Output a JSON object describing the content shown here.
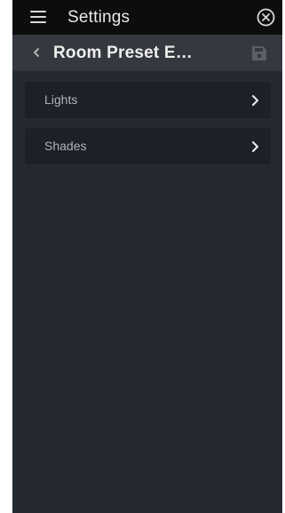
{
  "header": {
    "title": "Settings",
    "menu_icon": "hamburger-menu-icon",
    "close_icon": "close-circle-icon"
  },
  "subheader": {
    "title": "Room Preset E…",
    "back_icon": "chevron-left-icon",
    "save_icon": "floppy-disk-icon"
  },
  "items": [
    {
      "label": "Lights",
      "icon": "chevron-right-icon"
    },
    {
      "label": "Shades",
      "icon": "chevron-right-icon"
    }
  ],
  "colors": {
    "top_bar": "#0d0d0f",
    "sub_bar": "#35393f",
    "background": "#252a31",
    "row": "#1c2027",
    "text": "#e8e8e8",
    "muted_text": "#b0b4b9",
    "disabled_icon": "#5c6066"
  }
}
